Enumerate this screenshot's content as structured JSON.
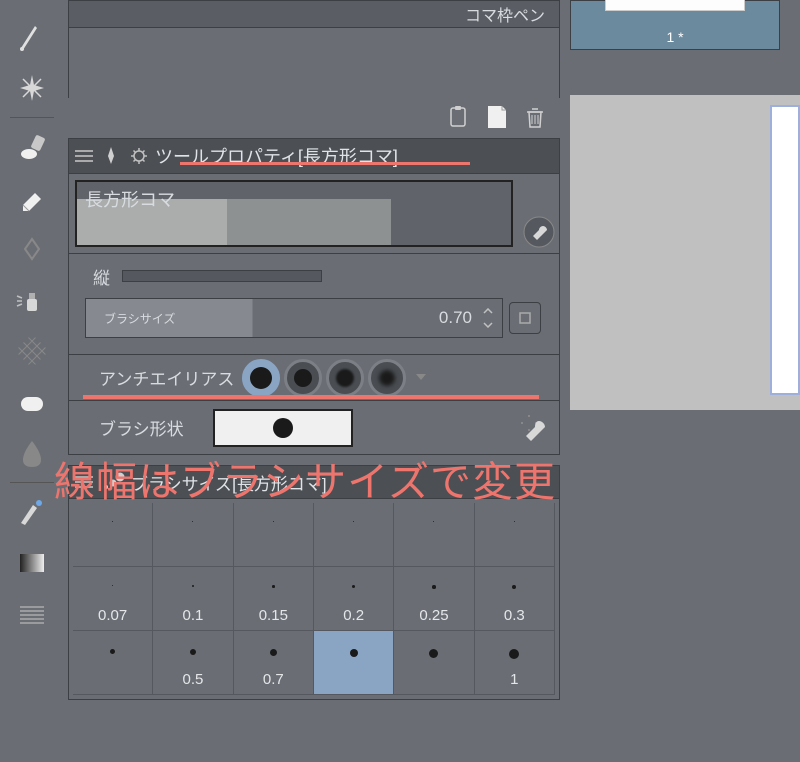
{
  "subtool": {
    "title": "コマ枠ペン"
  },
  "property_panel": {
    "title": "ツールプロパティ[長方形コマ]",
    "preset_name": "長方形コマ",
    "vertical_label": "縦",
    "brush_size_label": "ブラシサイズ",
    "brush_size_value": "0.70",
    "antialias_label": "アンチエイリアス",
    "brush_shape_label": "ブラシ形状"
  },
  "brush_panel": {
    "title": "ブラシサイズ[長方形コマ]",
    "sizes_row1": [
      "",
      "",
      "",
      "",
      "",
      ""
    ],
    "sizes_row2": [
      "0.07",
      "0.1",
      "0.15",
      "0.2",
      "0.25",
      "0.3"
    ],
    "sizes_row3": [
      "",
      "0.5",
      "0.7",
      "",
      "",
      "1"
    ],
    "dot_sizes_row1": [
      1,
      1,
      1,
      1,
      1,
      1
    ],
    "dot_sizes_row2": [
      1,
      2,
      2.5,
      3,
      3.5,
      4
    ],
    "dot_sizes_row3": [
      5,
      6,
      7,
      8,
      9,
      10
    ],
    "selected_index": 15
  },
  "navigator": {
    "thumb_label": "1 *"
  },
  "annotation": {
    "text": "線幅はブラシサイズで変更"
  },
  "icons": {
    "needle": "needle-icon",
    "sparkle": "sparkle-icon",
    "paint": "paint-icon",
    "eraser": "eraser-icon",
    "diamond": "diamond-icon",
    "airbrush": "airbrush-icon",
    "mesh": "mesh-icon",
    "eraser2": "eraser2-icon",
    "blend": "blend-icon",
    "brush2": "brush2-icon",
    "gradient": "gradient-icon",
    "lines": "lines-icon"
  }
}
